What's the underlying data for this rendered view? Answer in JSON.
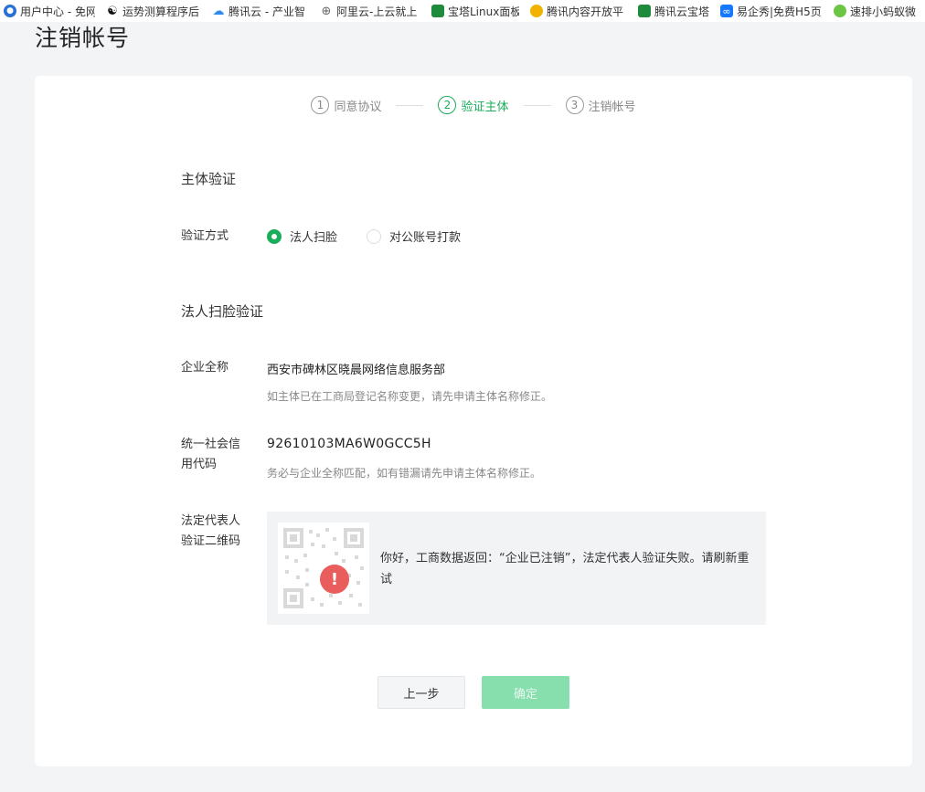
{
  "bookmarks": [
    {
      "label": "用户中心 - 免网",
      "icon": "user-center-icon",
      "color": "#2a6fd6",
      "glyph": "●"
    },
    {
      "label": "运势测算程序后",
      "icon": "yin-yang-icon",
      "color": "#111111",
      "glyph": "☯"
    },
    {
      "label": "腾讯云 - 产业智",
      "icon": "tencent-cloud-icon",
      "color": "#2e8cf0",
      "glyph": "☁"
    },
    {
      "label": "阿里云-上云就上",
      "icon": "globe-icon",
      "color": "#666666",
      "glyph": "⊕"
    },
    {
      "label": "宝塔Linux面板",
      "icon": "bt-shield-icon",
      "color": "#1f8a3b",
      "glyph": "●"
    },
    {
      "label": "腾讯内容开放平",
      "icon": "bell-icon",
      "color": "#f0b400",
      "glyph": "●"
    },
    {
      "label": "腾讯云宝塔",
      "icon": "bt-shield-icon",
      "color": "#1f8a3b",
      "glyph": "●"
    },
    {
      "label": "易企秀|免费H5页",
      "icon": "infinity-icon",
      "color": "#1677ff",
      "glyph": "∞"
    },
    {
      "label": "速排小蚂蚁微",
      "icon": "ant-icon",
      "color": "#6cc644",
      "glyph": "●"
    }
  ],
  "page": {
    "title": "注销帐号"
  },
  "steps": [
    {
      "num": "1",
      "label": "同意协议",
      "active": false
    },
    {
      "num": "2",
      "label": "验证主体",
      "active": true
    },
    {
      "num": "3",
      "label": "注销帐号",
      "active": false
    }
  ],
  "form": {
    "section1_title": "主体验证",
    "method_label": "验证方式",
    "method_options": [
      {
        "label": "法人扫脸",
        "checked": true
      },
      {
        "label": "对公账号打款",
        "checked": false
      }
    ],
    "section2_title": "法人扫脸验证",
    "company_label": "企业全称",
    "company_value": "西安市碑林区晓晨网络信息服务部",
    "company_hint": "如主体已在工商局登记名称变更，请先申请主体名称修正。",
    "credit_label_1": "统一社会信",
    "credit_label_2": "用代码",
    "credit_value": "92610103MA6W0GCC5H",
    "credit_hint": "务必与企业全称匹配，如有错漏请先申请主体名称修正。",
    "qr_label_1": "法定代表人",
    "qr_label_2": "验证二维码",
    "qr_error_glyph": "!",
    "qr_message": "你好，工商数据返回：“企业已注销”，法定代表人验证失败。请刷新重试"
  },
  "buttons": {
    "prev": "上一步",
    "confirm": "确定"
  },
  "colors": {
    "accent": "#1aad5a",
    "error": "#e95d5d",
    "confirm_disabled": "#86dfad"
  }
}
